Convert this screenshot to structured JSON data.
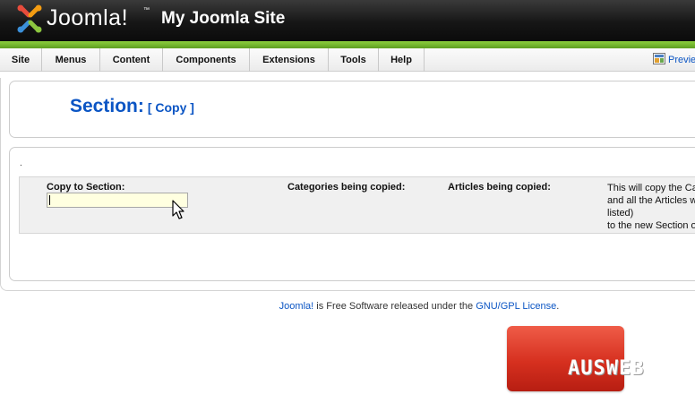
{
  "header": {
    "logo_text": "Joomla!",
    "logo_tm": "™",
    "site_title": "My Joomla Site",
    "colors": {
      "logo_red": "#e74c3c",
      "logo_orange": "#f39c12",
      "logo_green": "#8cc63f",
      "logo_blue": "#3b8fd9"
    }
  },
  "menu": {
    "items": [
      "Site",
      "Menus",
      "Content",
      "Components",
      "Extensions",
      "Tools",
      "Help"
    ],
    "preview_label": "Previe"
  },
  "toolbar": {
    "title": "Section:",
    "subtitle": "[ Copy ]"
  },
  "copy_form": {
    "dot": ".",
    "copy_to_label": "Copy to Section:",
    "copy_to_value": "",
    "categories_label": "Categories being copied:",
    "articles_label": "Articles being copied:",
    "description_lines": [
      "This will copy the Ca",
      "and all the Articles w",
      "listed)",
      "to the new Section o"
    ]
  },
  "footer": {
    "brand": "Joomla!",
    "text": " is Free Software released under the ",
    "license": "GNU/GPL License",
    "end": "."
  },
  "watermark": {
    "text": "AUSWEB",
    "color": "#d6301f"
  }
}
